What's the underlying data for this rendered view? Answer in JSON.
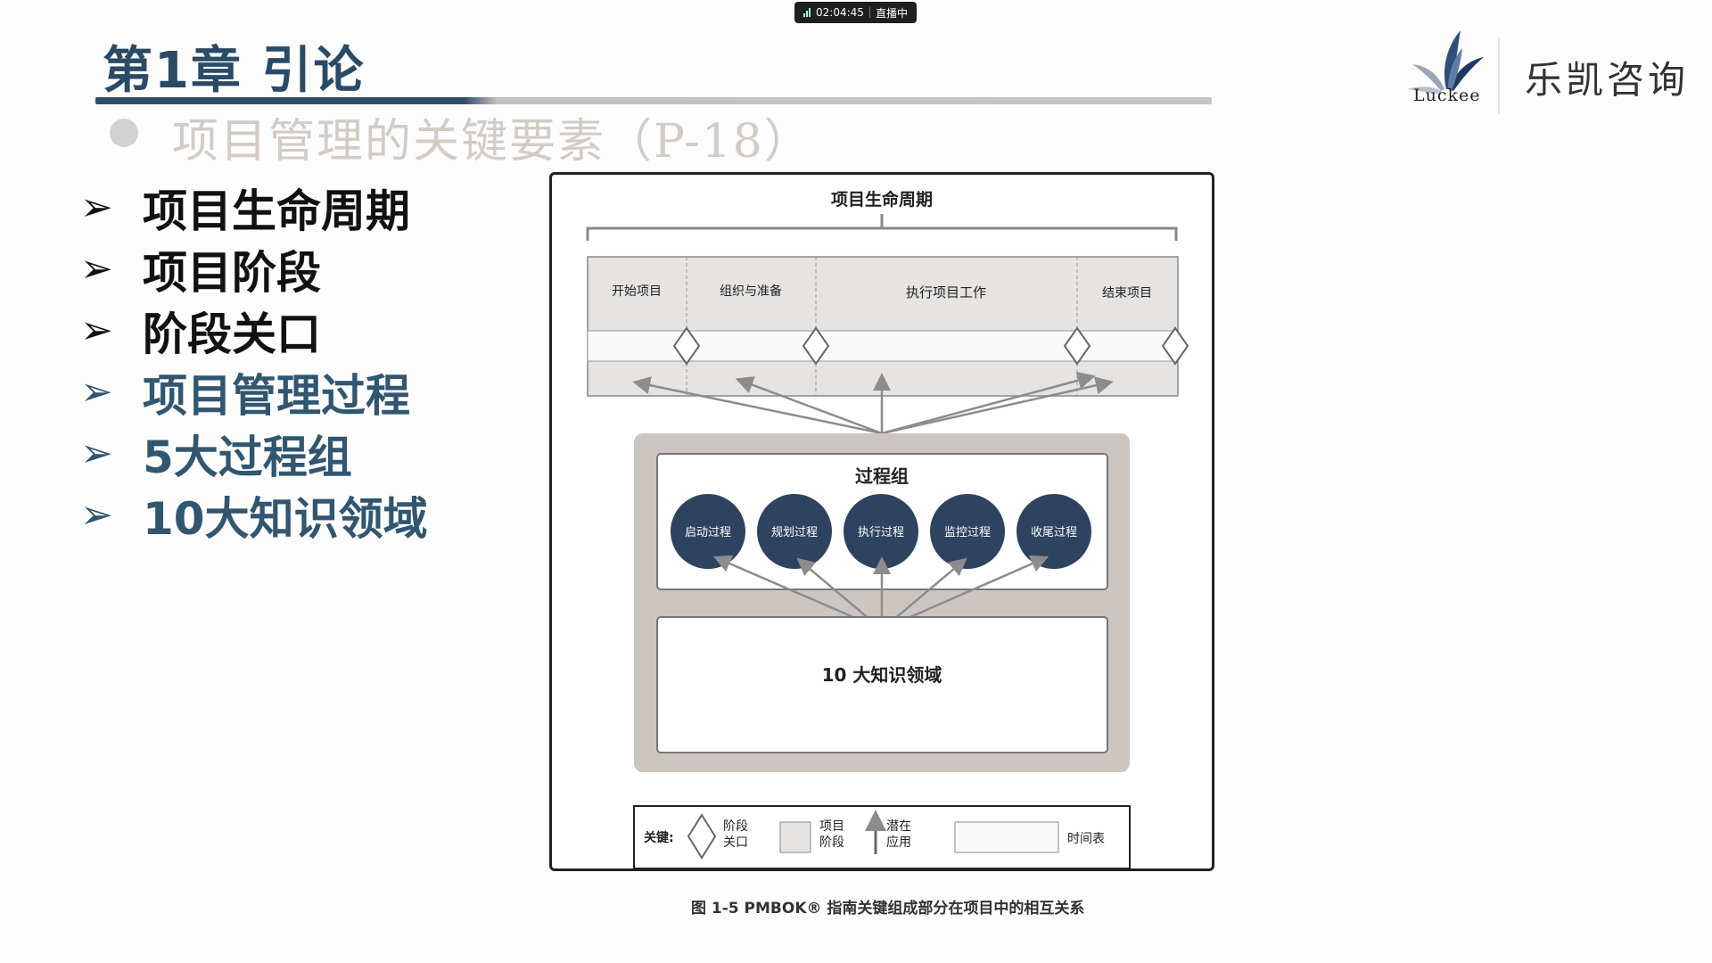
{
  "live_indicator": {
    "time": "02:04:45",
    "status": "直播中"
  },
  "header": {
    "chapter_title": "第1章 引论",
    "subtitle": "项目管理的关键要素（P-18）"
  },
  "list": [
    {
      "label": "项目生命周期"
    },
    {
      "label": "项目阶段"
    },
    {
      "label": "阶段关口"
    },
    {
      "label": "项目管理过程"
    },
    {
      "label": "5大过程组"
    },
    {
      "label": "10大知识领域"
    }
  ],
  "logo": {
    "wordmark": "Luckee",
    "brand_name": "乐凯咨询"
  },
  "figure": {
    "lifecycle_title": "项目生命周期",
    "phases": [
      "开始项目",
      "组织与准备",
      "执行项目工作",
      "结束项目"
    ],
    "process_groups_title": "过程组",
    "process_groups": [
      "启动过程",
      "规划过程",
      "执行过程",
      "监控过程",
      "收尾过程"
    ],
    "knowledge_areas": "10 大知识领域",
    "legend": {
      "key_label": "关键:",
      "gate_l1": "阶段",
      "gate_l2": "关口",
      "phase_l1": "项目",
      "phase_l2": "阶段",
      "app_l1": "潜在",
      "app_l2": "应用",
      "timeline": "时间表"
    },
    "caption": "图 1-5 PMBOK® 指南关键组成部分在项目中的相互关系"
  },
  "colors": {
    "title_blue": "#2b4a66",
    "list_blue": "#315670",
    "circle_navy": "#2e4360",
    "phase_fill": "#e6e3e0",
    "outer_box": "#cdc5bf"
  }
}
